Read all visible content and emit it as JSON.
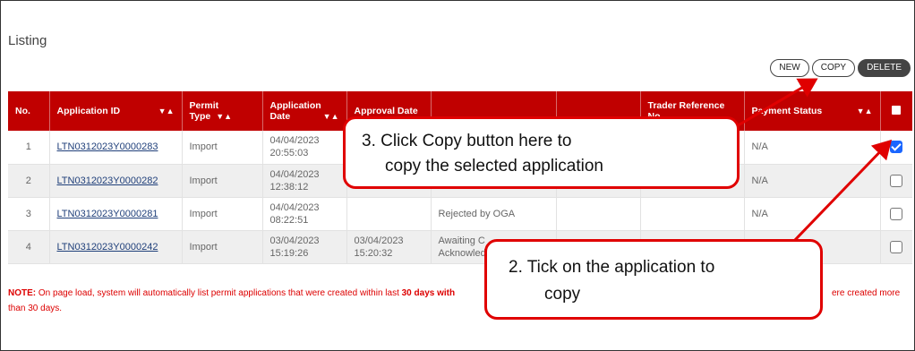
{
  "listing_title": "Listing",
  "buttons": {
    "new": "NEW",
    "copy": "COPY",
    "delete": "DELETE"
  },
  "table": {
    "headers": {
      "no": "No.",
      "app_id": "Application ID",
      "permit_type": "Permit Type",
      "app_date_1": "Application",
      "app_date_2": "Date",
      "approval_date": "Approval Date",
      "trader_ref": "Trader Reference No.",
      "payment_status": "Payment Status"
    },
    "sort_glyph": "▼▲",
    "rows": [
      {
        "no": "1",
        "app_id": "LTN0312023Y0000283",
        "permit_type": "Import",
        "app_date": "04/04/2023",
        "app_time": "20:55:03",
        "approval_date": "",
        "approval_time": "",
        "status_1": "",
        "status_2": "",
        "payment": "N/A",
        "checked": true
      },
      {
        "no": "2",
        "app_id": "LTN0312023Y0000282",
        "permit_type": "Import",
        "app_date": "04/04/2023",
        "app_time": "12:38:12",
        "approval_date": "",
        "approval_time": "",
        "status_1": "",
        "status_2": "",
        "payment": "N/A",
        "checked": false
      },
      {
        "no": "3",
        "app_id": "LTN0312023Y0000281",
        "permit_type": "Import",
        "app_date": "04/04/2023",
        "app_time": "08:22:51",
        "approval_date": "",
        "approval_time": "",
        "status_1": "Rejected by OGA",
        "status_2": "",
        "payment": "N/A",
        "checked": false
      },
      {
        "no": "4",
        "app_id": "LTN0312023Y0000242",
        "permit_type": "Import",
        "app_date": "03/04/2023",
        "app_time": "15:19:26",
        "approval_date": "03/04/2023",
        "approval_time": "15:20:32",
        "status_1": "Awaiting C",
        "status_2": "Acknowled",
        "payment": "",
        "checked": false
      }
    ]
  },
  "note": {
    "label": "NOTE:",
    "text": " On page load, system will automatically list permit applications that were created within last ",
    "bold": "30 days with",
    "tail_right": "ere created more",
    "line2": "than 30 days."
  },
  "callouts": {
    "copy_line1": "3.  Click Copy button here to",
    "copy_line2": "copy the selected application",
    "tick_line1": "2.  Tick on the application to",
    "tick_line2": "copy"
  },
  "colors": {
    "header_red": "#c00000",
    "callout_red": "#e00000",
    "checkbox_blue": "#1a66ff"
  }
}
